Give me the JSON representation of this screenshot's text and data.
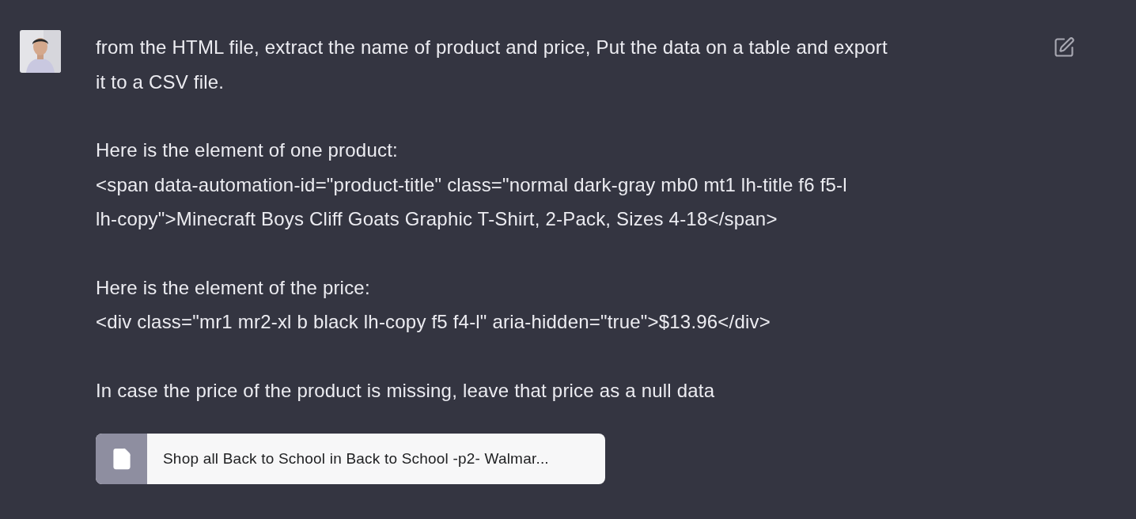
{
  "message": {
    "paragraphs": [
      [
        "from the HTML file, extract the name of product and price, Put the data on a table and export",
        "it to a CSV file."
      ],
      [
        "Here is the element of one product:",
        "<span data-automation-id=\"product-title\" class=\"normal dark-gray mb0 mt1 lh-title f6 f5-l",
        "lh-copy\">Minecraft Boys Cliff Goats Graphic T-Shirt, 2-Pack, Sizes 4-18</span>"
      ],
      [
        "Here is the element of the price:",
        "<div class=\"mr1 mr2-xl b black lh-copy f5 f4-l\" aria-hidden=\"true\">$13.96</div>"
      ],
      [
        "In case the price of the product is missing, leave that price as a null data"
      ]
    ],
    "attachment": {
      "name": "Shop all Back to School in Back to School -p2- Walmar..."
    }
  }
}
